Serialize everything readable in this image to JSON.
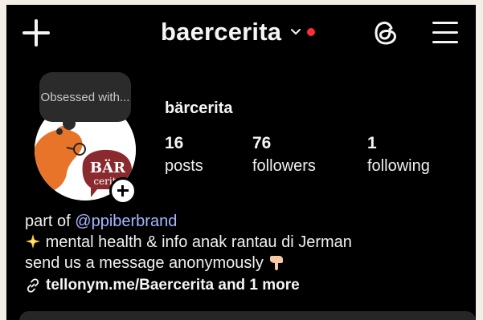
{
  "header": {
    "new_post_icon": "plus-icon",
    "username": "baercerita",
    "switch_icon": "chevron-down-icon",
    "notification_color": "#ff2d3a",
    "threads_icon": "threads-icon",
    "menu_icon": "hamburger-menu-icon"
  },
  "note": {
    "text": "Obsessed with..."
  },
  "profile": {
    "avatar_logo_text": "BÄR cerita",
    "display_name": "bärcerita",
    "stats": [
      {
        "count": "16",
        "label": "posts"
      },
      {
        "count": "76",
        "label": "followers"
      },
      {
        "count": "1",
        "label": "following"
      }
    ]
  },
  "bio": {
    "line1_prefix": "part of ",
    "line1_mention": "@ppiberbrand",
    "line2": "mental health & info anak rantau di Jerman",
    "line3": "send us a message anonymously",
    "link_text": "tellonym.me/Baercerita and 1 more",
    "mention_color": "#a7b6ff"
  }
}
